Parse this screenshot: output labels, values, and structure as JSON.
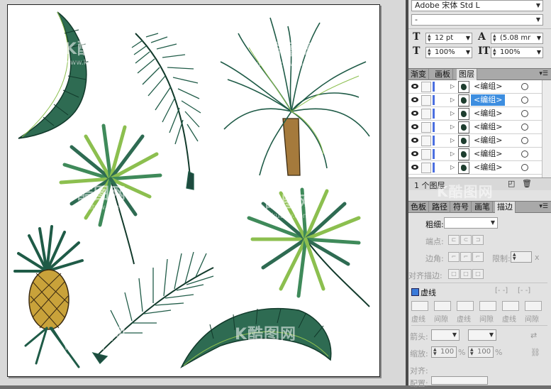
{
  "font": {
    "family_label": "Adobe 宋体 Std L",
    "style_value": "-",
    "size_value": "12 pt",
    "leading_value": "(5.08 mr",
    "vscale_value": "100%",
    "hscale_value": "100%"
  },
  "layers_panel": {
    "tabs": [
      "渐变",
      "画板",
      "图层"
    ],
    "active_tab": "图层",
    "items": [
      {
        "label": "<编组>",
        "selected": false
      },
      {
        "label": "<编组>",
        "selected": true
      },
      {
        "label": "<编组>",
        "selected": false
      },
      {
        "label": "<编组>",
        "selected": false
      },
      {
        "label": "<编组>",
        "selected": false
      },
      {
        "label": "<编组>",
        "selected": false
      },
      {
        "label": "<编组>",
        "selected": false
      }
    ],
    "footer_text": "1 个图层"
  },
  "stroke_panel": {
    "tabs": [
      "色板",
      "路径",
      "符号",
      "画笔",
      "描边"
    ],
    "active_tab": "描边",
    "weight_label": "粗细:",
    "cap_label": "端点:",
    "corner_label": "边角:",
    "limit_label": "限制:",
    "limit_unit": "x",
    "align_label": "对齐描边:",
    "dashed_label": "虚线",
    "dash_labels": [
      "虚线",
      "间隙",
      "虚线",
      "间隙",
      "虚线",
      "间隙"
    ],
    "arrow_label": "箭头:",
    "scale_label": "缩放:",
    "scale_values": [
      "100",
      "100"
    ],
    "scale_unit": "%",
    "align2_label": "对齐:",
    "profile_label": "配置:"
  },
  "watermarks": [
    {
      "text": "K酷图网",
      "sub": "www.kutuw.com"
    }
  ],
  "colors": {
    "selection": "#3d8ee0",
    "layer_color": "#4b6fe0",
    "leaf_dark": "#1d4a3e",
    "leaf_mid": "#3f8a5a",
    "leaf_light": "#8cbf4f",
    "pineapple": "#c9a23a"
  }
}
